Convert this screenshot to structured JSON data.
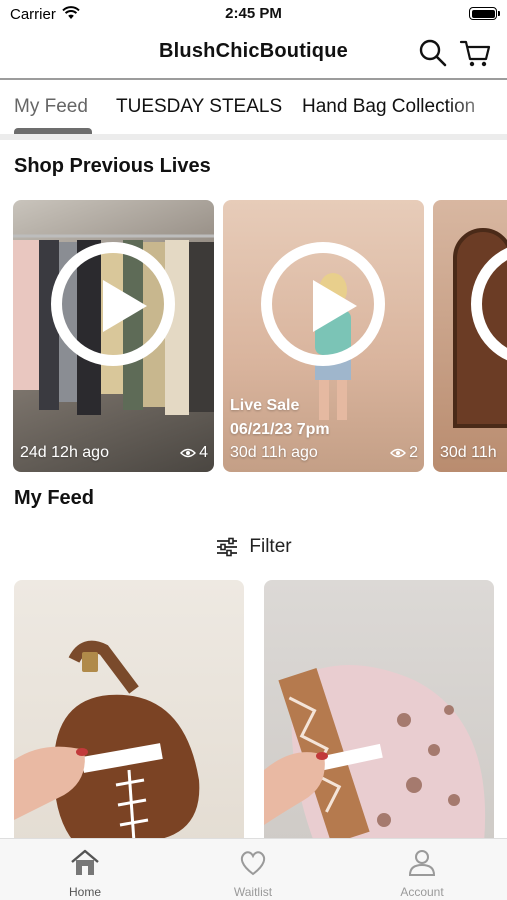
{
  "status_bar": {
    "carrier": "Carrier",
    "time": "2:45 PM"
  },
  "header": {
    "title": "BlushChicBoutique",
    "icons": [
      "search-icon",
      "cart-icon"
    ]
  },
  "tabs": [
    {
      "label": "My Feed",
      "selected": true
    },
    {
      "label": "TUESDAY STEALS",
      "selected": false
    },
    {
      "label": "Hand Bag Collection",
      "selected": false
    }
  ],
  "previous_lives": {
    "title": "Shop Previous Lives",
    "items": [
      {
        "badge_line1": "",
        "badge_line2": "",
        "ago": "24d 12h ago",
        "views": "4"
      },
      {
        "badge_line1": "Live Sale",
        "badge_line2": "06/21/23 7pm",
        "ago": "30d 11h ago",
        "views": "2"
      },
      {
        "badge_line1": "",
        "badge_line2": "",
        "ago": "30d 11h",
        "views": ""
      }
    ]
  },
  "feed": {
    "title": "My Feed",
    "filter_label": "Filter"
  },
  "bottom_nav": [
    {
      "label": "Home",
      "icon": "home-icon",
      "selected": true
    },
    {
      "label": "Waitlist",
      "icon": "heart-icon",
      "selected": false
    },
    {
      "label": "Account",
      "icon": "user-icon",
      "selected": false
    }
  ],
  "colors": {
    "tab_indicator": "#6d6d6d",
    "nav_active": "#555555",
    "nav_inactive": "#9a9a9a"
  }
}
